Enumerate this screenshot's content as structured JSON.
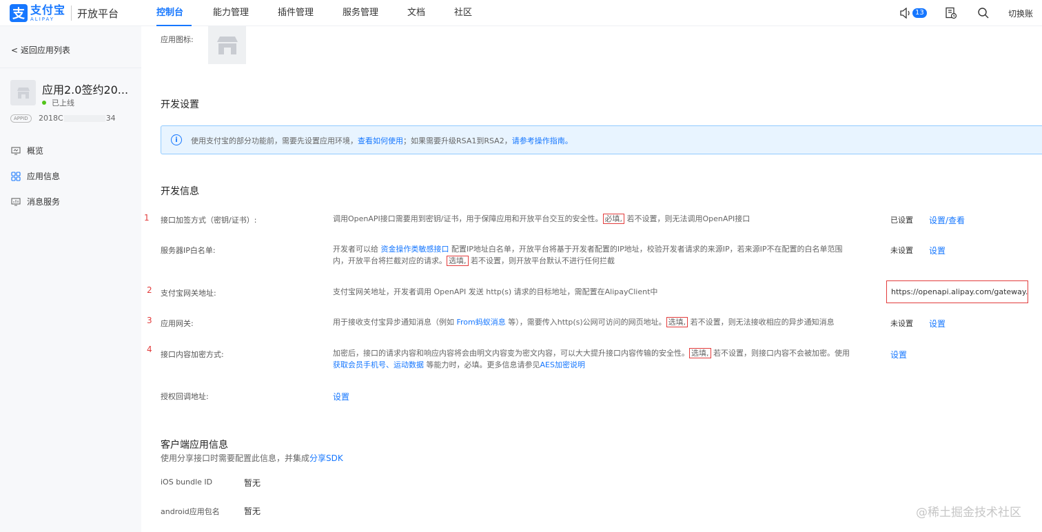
{
  "header": {
    "logo_cn": "支付宝",
    "logo_en": "ALIPAY",
    "platform": "开放平台",
    "nav": [
      "控制台",
      "能力管理",
      "插件管理",
      "服务管理",
      "文档",
      "社区"
    ],
    "notify_count": "13",
    "switch_account": "切换账"
  },
  "sidebar": {
    "back": "< 返回应用列表",
    "app_name": "应用2.0签约20...",
    "app_status": "已上线",
    "appid_tag": "APPID",
    "appid_prefix": "2018C",
    "appid_suffix": "34",
    "menu": [
      "概览",
      "应用信息",
      "消息服务"
    ]
  },
  "content": {
    "app_icon_label": "应用图标:",
    "dev_settings_title": "开发设置",
    "info_bar": {
      "t1": "使用支付宝的部分功能前，需要先设置应用环境，",
      "l1": "查看如何使用",
      "t2": "；如果需要升级RSA1到RSA2，",
      "l2": "请参考操作指南。"
    },
    "dev_info_title": "开发信息",
    "rows": {
      "sign": {
        "num": "1",
        "label": "接口加签方式（密钥/证书）:",
        "desc_a": "调用OpenAPI接口需要用到密钥/证书，用于保障应用和开放平台交互的安全性。",
        "desc_box": "必填,",
        "desc_b": " 若不设置，则无法调用OpenAPI接口",
        "status": "已设置",
        "action": "设置/查看"
      },
      "ip": {
        "label": "服务器IP白名单:",
        "desc_a": "开发者可以给 ",
        "desc_link": "资金操作类敏感接口",
        "desc_b": " 配置IP地址白名单，开放平台将基于开发者配置的IP地址，校验开发者请求的来源IP，若来源IP不在配置的白名单范围内，开放平台将拦截对应的请求。",
        "desc_box": "选填,",
        "desc_c": " 若不设置，则开放平台默认不进行任何拦截",
        "status": "未设置",
        "action": "设置"
      },
      "gateway": {
        "num": "2",
        "label": "支付宝网关地址:",
        "desc": "支付宝网关地址，开发者调用 OpenAPI 发送 http(s) 请求的目标地址，需配置在AlipayClient中",
        "value": "https://openapi.alipay.com/gateway.do"
      },
      "app_gw": {
        "num": "3",
        "label": "应用网关:",
        "desc_a": "用于接收支付宝异步通知消息（例如 ",
        "desc_link": "From蚂蚁消息",
        "desc_b": " 等），需要传入http(s)公网可访问的网页地址。",
        "desc_box": "选填,",
        "desc_c": " 若不设置，则无法接收相应的异步通知消息",
        "status": "未设置",
        "action": "设置"
      },
      "encrypt": {
        "num": "4",
        "label": "接口内容加密方式:",
        "desc_a": "加密后，接口的请求内容和响应内容将会由明文内容变为密文内容，可以大大提升接口内容传输的安全性。",
        "desc_box": "选填,",
        "desc_b": " 若不设置，则接口内容不会被加密。使用 ",
        "desc_link1": "获取会员手机号",
        "desc_sep": "、",
        "desc_link2": "运动数据",
        "desc_c": " 等能力时，必填。更多信息请参见",
        "desc_link3": "AES加密说明",
        "action": "设置"
      },
      "auth": {
        "label": "授权回调地址:",
        "action": "设置"
      }
    },
    "client_title": "客户端应用信息",
    "client_desc_a": "使用分享接口时需要配置此信息，并集成",
    "client_desc_link": "分享SDK",
    "ios_label": "iOS bundle ID",
    "ios_value": "暂无",
    "android_label": "android应用包名",
    "android_value": "暂无"
  },
  "watermark": "@稀土掘金技术社区"
}
